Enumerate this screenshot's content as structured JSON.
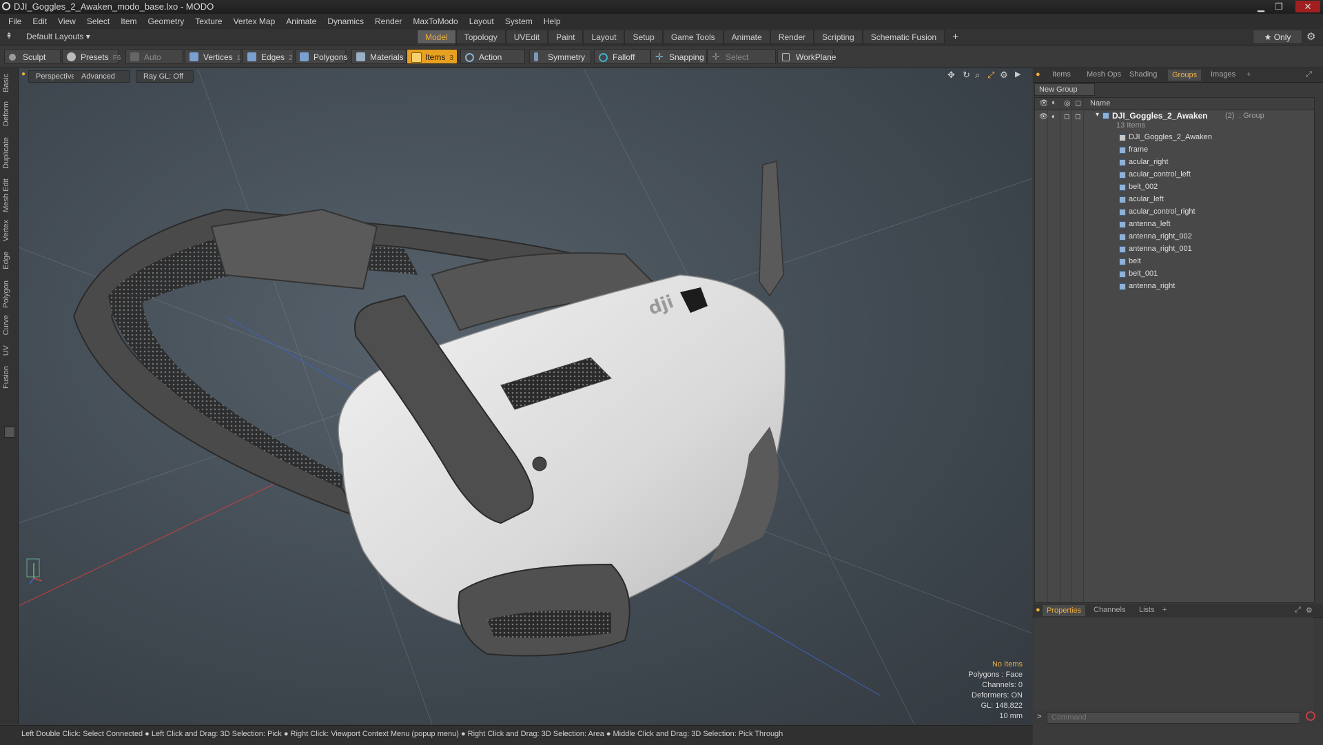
{
  "window": {
    "title": "DJI_Goggles_2_Awaken_modo_base.lxo - MODO",
    "min": "▁",
    "max": "❐",
    "close": "✕"
  },
  "menu": [
    "File",
    "Edit",
    "View",
    "Select",
    "Item",
    "Geometry",
    "Texture",
    "Vertex Map",
    "Animate",
    "Dynamics",
    "Render",
    "MaxToModo",
    "Layout",
    "System",
    "Help"
  ],
  "layouts": {
    "dropdown": "Default Layouts ▾",
    "tabs": [
      "Model",
      "Topology",
      "UVEdit",
      "Paint",
      "Layout",
      "Setup",
      "Game Tools",
      "Animate",
      "Render",
      "Scripting",
      "Schematic Fusion"
    ],
    "active": "Model",
    "add": "+",
    "only": "★ Only"
  },
  "toolbar": {
    "sculpt": "Sculpt",
    "presets": "Presets",
    "presets_key": "F6",
    "auto_select": "Auto Select",
    "vertices": "Vertices",
    "vertices_count": "1",
    "edges": "Edges",
    "edges_count": "2",
    "polygons": "Polygons",
    "materials": "Materials",
    "items": "Items",
    "items_count": "3",
    "action_center": "Action Center",
    "symmetry": "Symmetry",
    "falloff": "Falloff",
    "snapping": "Snapping",
    "select_through": "Select Through",
    "workplane": "WorkPlane"
  },
  "leftbar": [
    "Basic",
    "Deform",
    "Duplicate",
    "Mesh Edit",
    "Vertex",
    "Edge",
    "Polygon",
    "Curve",
    "UV",
    "Fusion"
  ],
  "viewport": {
    "perspective": "Perspective",
    "advanced": "Advanced",
    "raygl": "Ray GL: Off",
    "info": {
      "no_items": "No Items",
      "polygons": "Polygons : Face",
      "channels": "Channels: 0",
      "deformers": "Deformers: ON",
      "gl": "GL: 148,822",
      "unit": "10 mm"
    },
    "brand": "dji"
  },
  "panel": {
    "tabs": [
      "Items",
      "Mesh Ops",
      "Shading",
      "Groups",
      "Images"
    ],
    "active": "Groups",
    "add": "+",
    "new_group": "New Group",
    "col_name": "Name",
    "group": {
      "name": "DJI_Goggles_2_Awaken",
      "count": "(2)",
      "type": ": Group",
      "items": "13 Items"
    },
    "items": [
      "DJI_Goggles_2_Awaken",
      "frame",
      "acular_right",
      "acular_control_left",
      "belt_002",
      "acular_left",
      "acular_control_right",
      "antenna_left",
      "antenna_right_002",
      "antenna_right_001",
      "belt",
      "belt_001",
      "antenna_right"
    ],
    "bottom_tabs": [
      "Properties",
      "Channels",
      "Lists"
    ],
    "bottom_active": "Properties",
    "command_placeholder": "Command"
  },
  "status": "Left Double Click: Select Connected ● Left Click and Drag: 3D Selection: Pick ● Right Click: Viewport Context Menu (popup menu) ● Right Click and Drag: 3D Selection: Area ● Middle Click and Drag: 3D Selection: Pick Through",
  "colors": {
    "accent": "#f0b040",
    "items_active": "#e8a020"
  }
}
